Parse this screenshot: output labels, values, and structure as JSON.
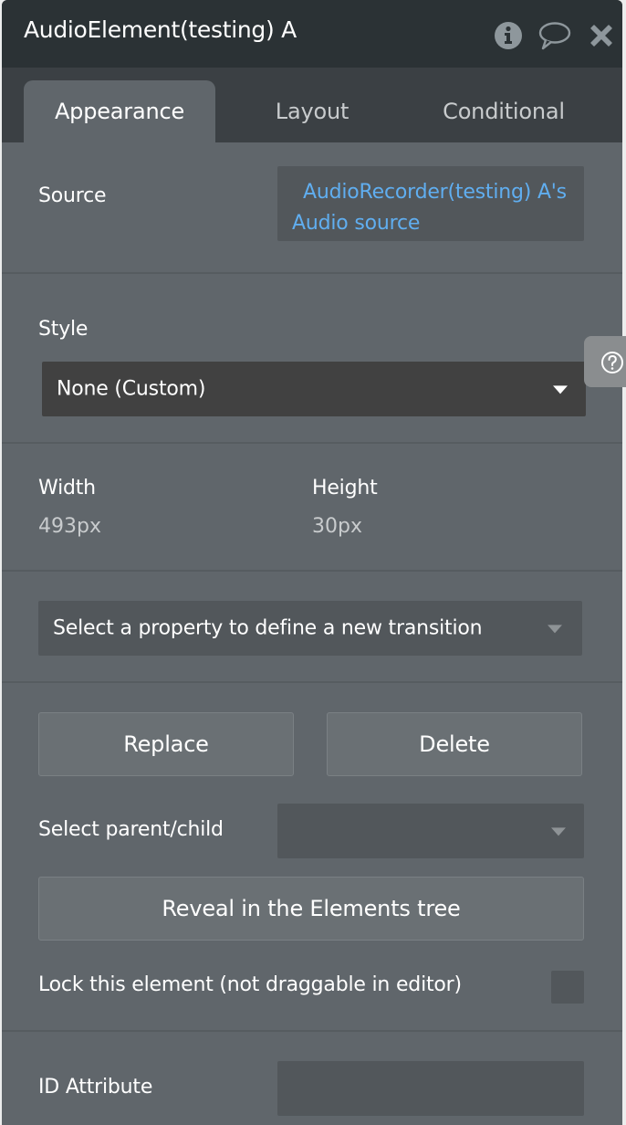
{
  "header": {
    "title": "AudioElement(testing) A",
    "icons": [
      "info-icon",
      "comment-icon",
      "close-icon"
    ]
  },
  "tabs": [
    {
      "label": "Appearance",
      "active": true
    },
    {
      "label": "Layout",
      "active": false
    },
    {
      "label": "Conditional",
      "active": false
    }
  ],
  "source": {
    "label": "Source",
    "value_line1": "AudioRecorder(testing) A's",
    "value_line2": "Audio source"
  },
  "style": {
    "label": "Style",
    "selected": "None (Custom)"
  },
  "dimensions": {
    "width_label": "Width",
    "width_value": "493px",
    "height_label": "Height",
    "height_value": "30px"
  },
  "transition": {
    "placeholder": "Select a property to define a new transition"
  },
  "actions": {
    "replace_label": "Replace",
    "delete_label": "Delete",
    "parent_child_label": "Select parent/child",
    "parent_child_selected": "",
    "reveal_label": "Reveal in the Elements tree",
    "lock_label": "Lock this element (not draggable in editor)",
    "lock_checked": false
  },
  "id_attribute": {
    "label": "ID Attribute",
    "value": ""
  },
  "colors": {
    "header_bg": "#2b3235",
    "tabbar_bg": "#3b4044",
    "panel_bg": "#60666b",
    "link": "#60aef0",
    "dropdown_dark": "#414141",
    "field_bg": "#52575b"
  }
}
